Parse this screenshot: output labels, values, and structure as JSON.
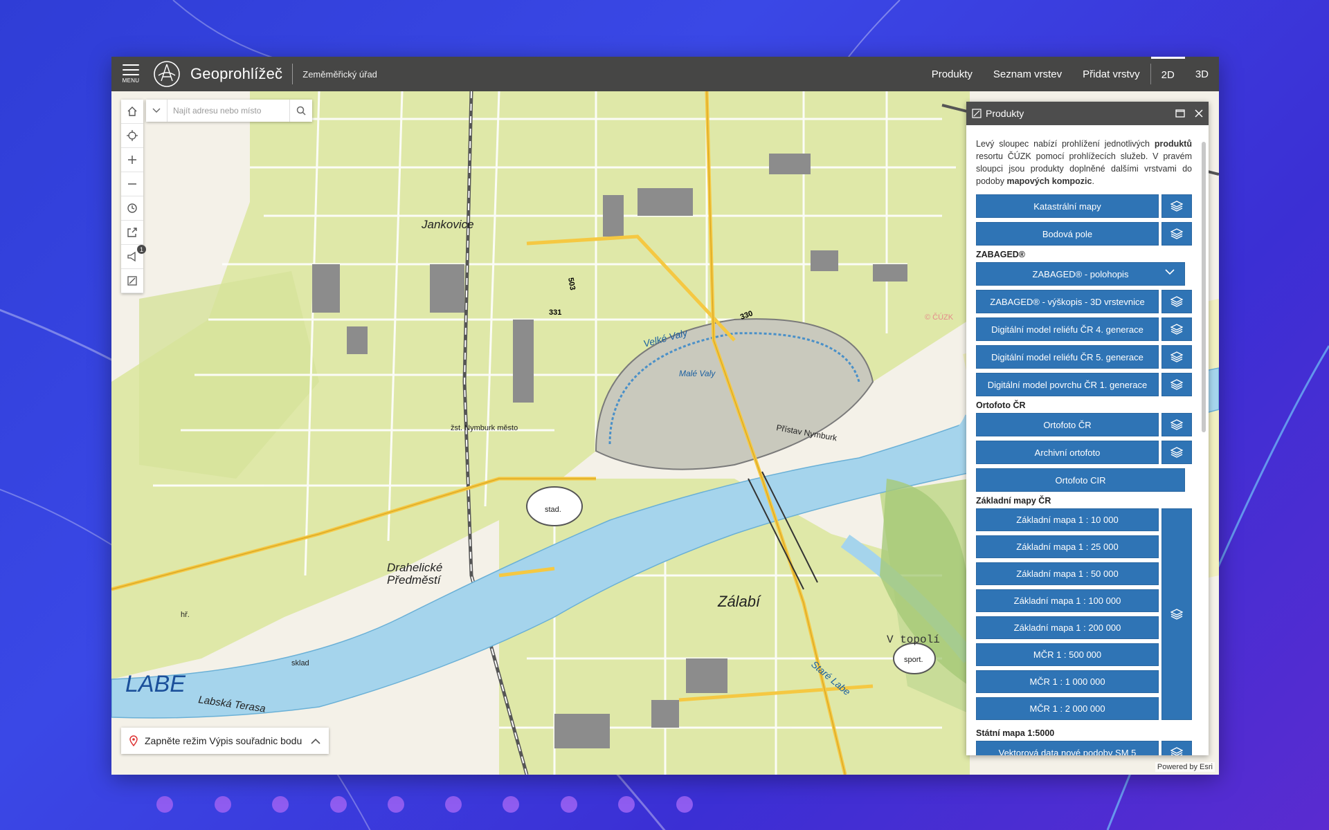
{
  "header": {
    "menu_label": "MENU",
    "title": "Geoprohlížeč",
    "organization": "Zeměměřický úřad",
    "nav": [
      {
        "label": "Produkty"
      },
      {
        "label": "Seznam vrstev"
      },
      {
        "label": "Přidat vrstvy"
      },
      {
        "label": "2D",
        "active": true
      },
      {
        "label": "3D"
      }
    ]
  },
  "search": {
    "placeholder": "Najít adresu nebo místo"
  },
  "toolbar": {
    "icons": [
      "home-icon",
      "locate-icon",
      "zoom-in-icon",
      "zoom-out-icon",
      "history-icon",
      "share-icon",
      "notifications-icon",
      "legend-icon"
    ],
    "notification_count": "1"
  },
  "coord_panel": {
    "label": "Zapněte režim Výpis souřadnic bodu"
  },
  "attribution": "Powered by Esri",
  "map": {
    "labels": {
      "labe": "LABE",
      "jankovice": "Jankovice",
      "zalabi": "Zálabí",
      "drahelicke": "Drahelické",
      "predmesti": "Předměstí",
      "labska_terasa": "Labská Terasa",
      "v_topoli": "V topolí",
      "stare_labe": "Staré Labe",
      "velke_valy": "Velké Valy",
      "male_valy": "Malé Valy",
      "pristav": "Přístav Nymburk",
      "zst_nymburk": "žst. Nymburk město",
      "road_503": "503",
      "road_330": "330",
      "road_331": "331",
      "stad": "stad.",
      "sport": "sport.",
      "hr": "hř.",
      "sklad": "sklad",
      "copyright": "© ČÚZK"
    }
  },
  "products_panel": {
    "title": "Produkty",
    "intro_parts": [
      "Levý sloupec nabízí prohlížení jednotlivých ",
      "produktů",
      " resortu ČÚZK pomocí prohlížecích služeb. V pravém sloupci jsou produkty doplněné dalšími vrstvami do podoby ",
      "mapových kompozic",
      "."
    ],
    "items_top": [
      {
        "label": "Katastrální mapy"
      },
      {
        "label": "Bodová pole"
      }
    ],
    "zabaged_title": "ZABAGED®",
    "zabaged_items": [
      {
        "label": "ZABAGED® - polohopis",
        "dropdown": true
      },
      {
        "label": "ZABAGED® - výškopis - 3D vrstevnice"
      },
      {
        "label": "Digitální model reliéfu ČR 4. generace"
      },
      {
        "label": "Digitální model reliéfu ČR 5. generace"
      },
      {
        "label": "Digitální model povrchu ČR 1. generace"
      }
    ],
    "ortofoto_title": "Ortofoto ČR",
    "ortofoto_items": [
      {
        "label": "Ortofoto ČR"
      },
      {
        "label": "Archivní ortofoto"
      },
      {
        "label": "Ortofoto CIR"
      }
    ],
    "zakladni_title": "Základní mapy ČR",
    "zakladni_items": [
      "Základní mapa 1 : 10 000",
      "Základní mapa 1 : 25 000",
      "Základní mapa 1 : 50 000",
      "Základní mapa 1 : 100 000",
      "Základní mapa 1 : 200 000",
      "MČR 1 : 500 000",
      "MČR 1 : 1 000 000",
      "MČR 1 : 2 000 000"
    ],
    "statni_title": "Státní mapa 1:5000",
    "statni_items": [
      {
        "label": "Vektorová data nové podoby SM 5"
      }
    ]
  }
}
